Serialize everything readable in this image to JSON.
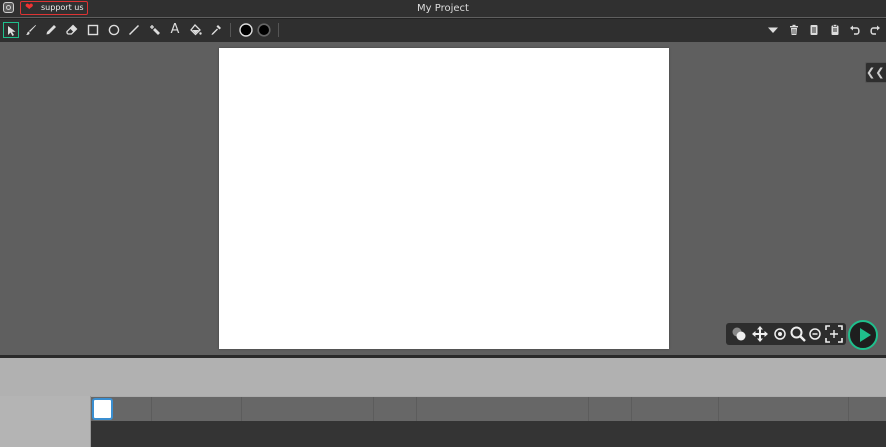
{
  "app": {
    "title": "My Project",
    "support_label": "support us"
  },
  "toolbar": {
    "left_tools": [
      "select-icon",
      "brush-icon",
      "pencil-icon",
      "eraser-icon",
      "rectangle-icon",
      "ellipse-icon",
      "line-icon",
      "pen-icon",
      "text-icon",
      "fill-bucket-icon",
      "eyedropper-icon"
    ],
    "text_tool_glyph": "A",
    "stroke_color": "#000000",
    "fill_color": "#000000",
    "right_tools": [
      "dropdown-icon",
      "trash-icon",
      "copy-icon",
      "paste-icon",
      "undo-icon",
      "redo-icon"
    ]
  },
  "colors": {
    "accent": "#1fbf8c",
    "canvas": "#ffffff",
    "background": "#5f5f5f",
    "selected_frame": "#3a8ed0"
  },
  "view_controls": [
    "onion-skin-icon",
    "pan-icon",
    "zoom-in-icon",
    "zoom-icon",
    "zoom-out-icon",
    "fit-screen-icon"
  ],
  "side_toggle_glyph": "❮❮❮"
}
